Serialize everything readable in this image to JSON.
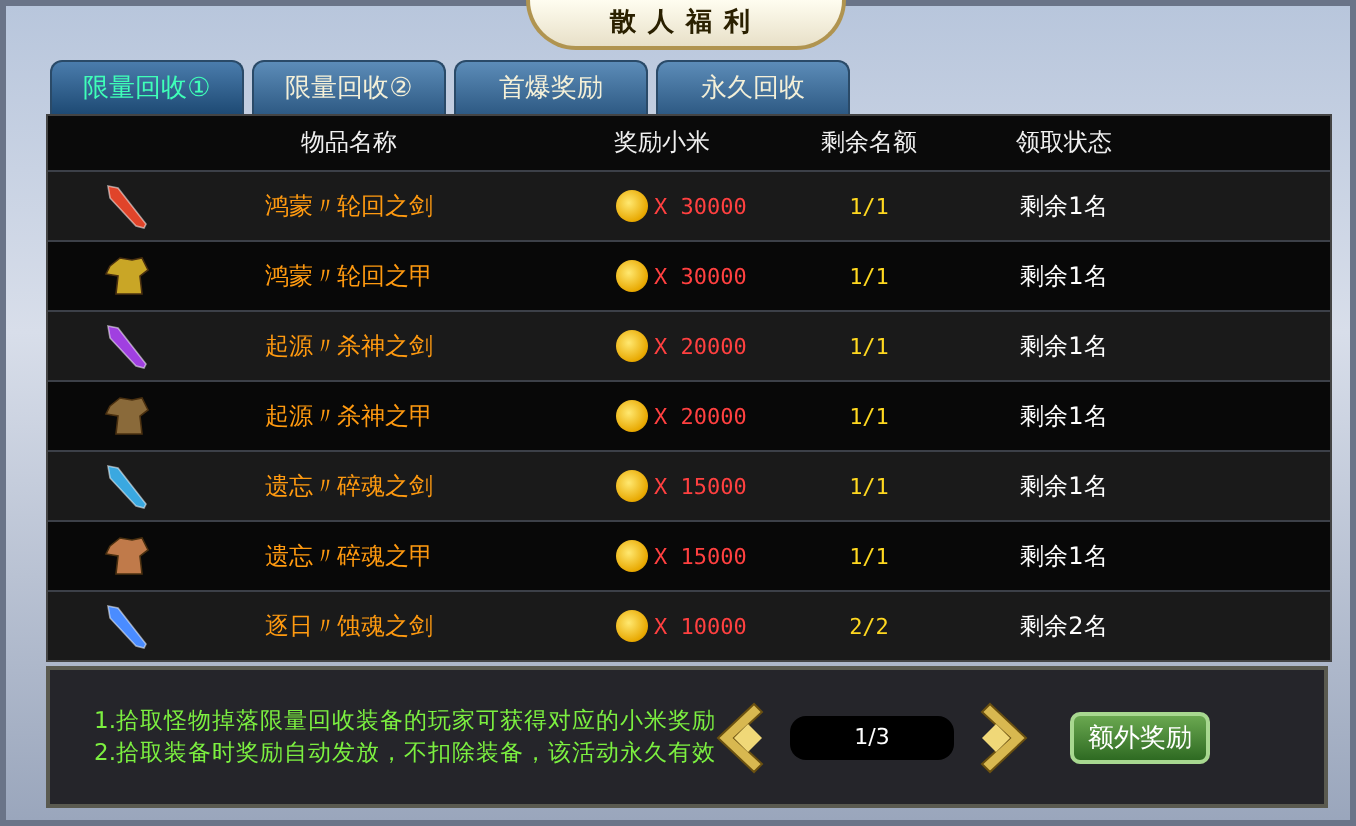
{
  "title": "散人福利",
  "tabs": [
    {
      "label": "限量回收①",
      "selected": true
    },
    {
      "label": "限量回收②",
      "selected": false
    },
    {
      "label": "首爆奖励",
      "selected": false
    },
    {
      "label": "永久回收",
      "selected": false
    }
  ],
  "table": {
    "columns": [
      "物品名称",
      "奖励小米",
      "剩余名额",
      "领取状态"
    ],
    "rows": [
      {
        "kind": "sword",
        "color": "#e0442a",
        "name": "鸿蒙〃轮回之剑",
        "reward": "X 30000",
        "quota": "1/1",
        "status": "剩余1名"
      },
      {
        "kind": "armor",
        "color": "#c9a626",
        "name": "鸿蒙〃轮回之甲",
        "reward": "X 30000",
        "quota": "1/1",
        "status": "剩余1名"
      },
      {
        "kind": "sword",
        "color": "#a040e0",
        "name": "起源〃杀神之剑",
        "reward": "X 20000",
        "quota": "1/1",
        "status": "剩余1名"
      },
      {
        "kind": "armor",
        "color": "#8a6a3a",
        "name": "起源〃杀神之甲",
        "reward": "X 20000",
        "quota": "1/1",
        "status": "剩余1名"
      },
      {
        "kind": "sword",
        "color": "#3aa8e0",
        "name": "遗忘〃碎魂之剑",
        "reward": "X 15000",
        "quota": "1/1",
        "status": "剩余1名"
      },
      {
        "kind": "armor",
        "color": "#c07a4a",
        "name": "遗忘〃碎魂之甲",
        "reward": "X 15000",
        "quota": "1/1",
        "status": "剩余1名"
      },
      {
        "kind": "sword",
        "color": "#4a8cff",
        "name": "逐日〃蚀魂之剑",
        "reward": "X 10000",
        "quota": "2/2",
        "status": "剩余2名"
      }
    ]
  },
  "notes": [
    "1.拾取怪物掉落限量回收装备的玩家可获得对应的小米奖励",
    "2.拾取装备时奖励自动发放，不扣除装备，该活动永久有效"
  ],
  "pager": {
    "page": "1/3"
  },
  "extra_button": "额外奖励"
}
